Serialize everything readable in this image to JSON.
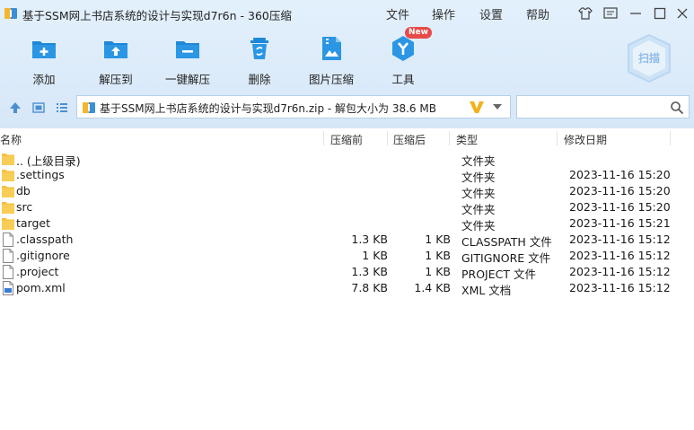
{
  "window": {
    "title": "基于SSM网上书店系统的设计与实现d7r6n - 360压缩",
    "menus": [
      "文件",
      "操作",
      "设置",
      "帮助"
    ]
  },
  "toolbar": {
    "items": [
      {
        "label": "添加",
        "icon": "add-folder-icon"
      },
      {
        "label": "解压到",
        "icon": "extract-to-icon"
      },
      {
        "label": "一键解压",
        "icon": "one-click-extract-icon"
      },
      {
        "label": "删除",
        "icon": "recycle-bin-icon"
      },
      {
        "label": "图片压缩",
        "icon": "image-compress-icon"
      },
      {
        "label": "工具",
        "icon": "tools-icon",
        "badge": "New"
      }
    ],
    "scan_label": "扫描"
  },
  "address": {
    "path": "基于SSM网上书店系统的设计与实现d7r6n.zip - 解包大小为 38.6 MB"
  },
  "columns": {
    "name": "名称",
    "original": "压缩前",
    "compressed": "压缩后",
    "type": "类型",
    "modified": "修改日期"
  },
  "files": [
    {
      "name": ".. (上级目录)",
      "original": "",
      "compressed": "",
      "type": "文件夹",
      "date": "",
      "icon": "folder"
    },
    {
      "name": ".settings",
      "original": "",
      "compressed": "",
      "type": "文件夹",
      "date": "2023-11-16 15:20",
      "icon": "folder"
    },
    {
      "name": "db",
      "original": "",
      "compressed": "",
      "type": "文件夹",
      "date": "2023-11-16 15:20",
      "icon": "folder"
    },
    {
      "name": "src",
      "original": "",
      "compressed": "",
      "type": "文件夹",
      "date": "2023-11-16 15:20",
      "icon": "folder"
    },
    {
      "name": "target",
      "original": "",
      "compressed": "",
      "type": "文件夹",
      "date": "2023-11-16 15:21",
      "icon": "folder"
    },
    {
      "name": ".classpath",
      "original": "1.3 KB",
      "compressed": "1 KB",
      "type": "CLASSPATH 文件",
      "date": "2023-11-16 15:12",
      "icon": "file"
    },
    {
      "name": ".gitignore",
      "original": "1 KB",
      "compressed": "1 KB",
      "type": "GITIGNORE 文件",
      "date": "2023-11-16 15:12",
      "icon": "file"
    },
    {
      "name": ".project",
      "original": "1.3 KB",
      "compressed": "1 KB",
      "type": "PROJECT 文件",
      "date": "2023-11-16 15:12",
      "icon": "file"
    },
    {
      "name": "pom.xml",
      "original": "7.8 KB",
      "compressed": "1.4 KB",
      "type": "XML 文档",
      "date": "2023-11-16 15:12",
      "icon": "xml"
    }
  ],
  "colors": {
    "chrome": "#dcebfa",
    "accent": "#1e88d8",
    "folder": "#f5c242",
    "badge": "#e84a4a"
  }
}
